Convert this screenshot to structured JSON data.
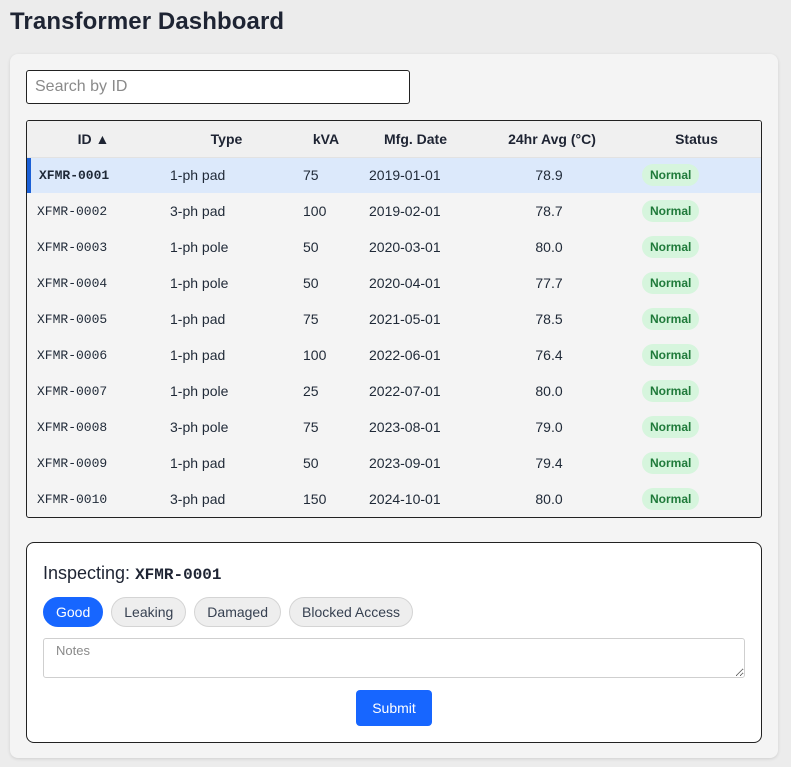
{
  "page": {
    "title": "Transformer Dashboard"
  },
  "search": {
    "placeholder": "Search by ID",
    "value": ""
  },
  "table": {
    "columns": [
      "ID ▲",
      "Type",
      "kVA",
      "Mfg. Date",
      "24hr Avg (°C)",
      "Status"
    ],
    "rows": [
      {
        "id": "XFMR-0001",
        "type": "1-ph pad",
        "kva": "75",
        "date": "2019-01-01",
        "avg": "78.9",
        "status": "Normal"
      },
      {
        "id": "XFMR-0002",
        "type": "3-ph pad",
        "kva": "100",
        "date": "2019-02-01",
        "avg": "78.7",
        "status": "Normal"
      },
      {
        "id": "XFMR-0003",
        "type": "1-ph pole",
        "kva": "50",
        "date": "2020-03-01",
        "avg": "80.0",
        "status": "Normal"
      },
      {
        "id": "XFMR-0004",
        "type": "1-ph pole",
        "kva": "50",
        "date": "2020-04-01",
        "avg": "77.7",
        "status": "Normal"
      },
      {
        "id": "XFMR-0005",
        "type": "1-ph pad",
        "kva": "75",
        "date": "2021-05-01",
        "avg": "78.5",
        "status": "Normal"
      },
      {
        "id": "XFMR-0006",
        "type": "1-ph pad",
        "kva": "100",
        "date": "2022-06-01",
        "avg": "76.4",
        "status": "Normal"
      },
      {
        "id": "XFMR-0007",
        "type": "1-ph pole",
        "kva": "25",
        "date": "2022-07-01",
        "avg": "80.0",
        "status": "Normal"
      },
      {
        "id": "XFMR-0008",
        "type": "3-ph pole",
        "kva": "75",
        "date": "2023-08-01",
        "avg": "79.0",
        "status": "Normal"
      },
      {
        "id": "XFMR-0009",
        "type": "1-ph pad",
        "kva": "50",
        "date": "2023-09-01",
        "avg": "79.4",
        "status": "Normal"
      },
      {
        "id": "XFMR-0010",
        "type": "3-ph pad",
        "kva": "150",
        "date": "2024-10-01",
        "avg": "80.0",
        "status": "Normal"
      }
    ]
  },
  "inspect": {
    "label": "Inspecting:",
    "selected_id": "XFMR-0001",
    "options": [
      "Good",
      "Leaking",
      "Damaged",
      "Blocked Access"
    ],
    "active_option": "Good",
    "notes_placeholder": "Notes",
    "submit_label": "Submit"
  },
  "colors": {
    "accent": "#1766ff",
    "selected_row": "#dce9fb",
    "status_normal_bg": "#d6f5dd",
    "status_normal_text": "#1f7a3a"
  }
}
